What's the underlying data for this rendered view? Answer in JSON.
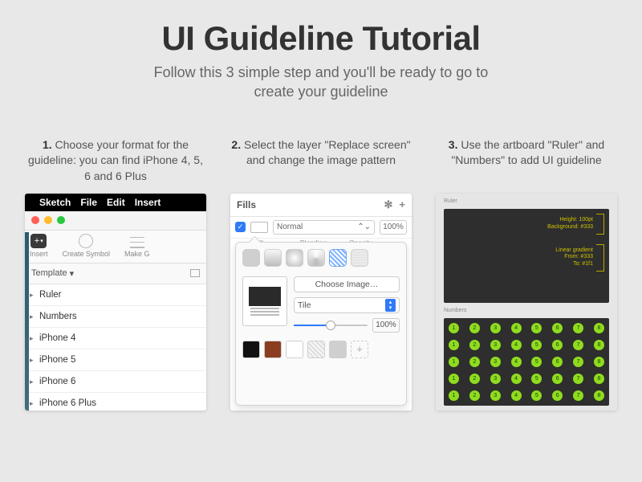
{
  "title": "UI Guideline Tutorial",
  "subtitle_l1": "Follow this 3 simple step and you'll be ready to go to",
  "subtitle_l2": "create your guideline",
  "steps": {
    "s1": {
      "num": "1.",
      "text": "Choose your format for the guideline: you can find iPhone 4, 5, 6 and 6 Plus"
    },
    "s2": {
      "num": "2.",
      "text": "Select the layer \"Replace screen\" and change the image pattern"
    },
    "s3": {
      "num": "3.",
      "text": "Use the artboard \"Ruler\" and \"Numbers\" to add UI guideline"
    }
  },
  "sketch": {
    "menu": {
      "app": "Sketch",
      "file": "File",
      "edit": "Edit",
      "insert": "Insert"
    },
    "toolbar": {
      "insert": "Insert",
      "create_symbol": "Create Symbol",
      "make_grid": "Make G"
    },
    "template_label": "Template",
    "templates": {
      "ruler": "Ruler",
      "numbers": "Numbers",
      "ip4": "iPhone 4",
      "ip5": "iPhone 5",
      "ip6": "iPhone 6",
      "ip6p": "iPhone 6 Plus"
    }
  },
  "fills": {
    "header": "Fills",
    "blending": "Normal",
    "opacity": "100%",
    "lab_fill": "Fill",
    "lab_blend": "Blending",
    "lab_opac": "Opacity",
    "choose_image": "Choose Image…",
    "tile": "Tile",
    "scale": "100%"
  },
  "artboards": {
    "ruler_label": "Ruler",
    "ruler_m1_l1": "Height: 100pt",
    "ruler_m1_l2": "Background: #333",
    "ruler_m2_l1": "Linear gradient",
    "ruler_m2_l2": "From: #333",
    "ruler_m2_l3": "To: #1f1",
    "numbers_label": "Numbers"
  }
}
